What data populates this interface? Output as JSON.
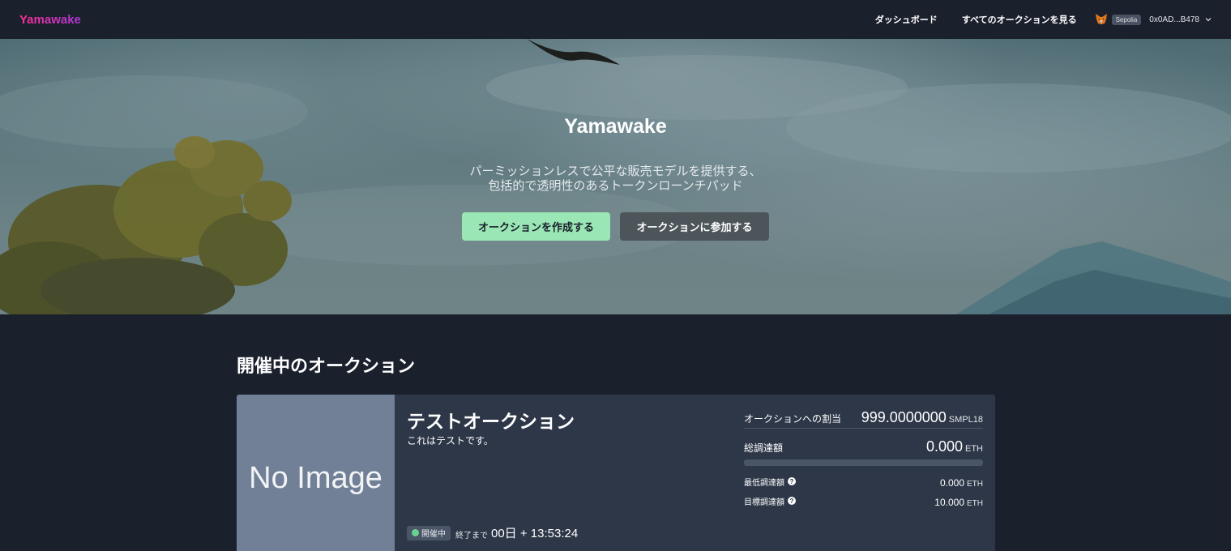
{
  "header": {
    "logo": "Yamawake",
    "nav": {
      "dashboard": "ダッシュボード",
      "all_auctions": "すべてのオークションを見る"
    },
    "wallet": {
      "network": "Sepolia",
      "address": "0x0AD...B478"
    }
  },
  "hero": {
    "title": "Yamawake",
    "subtitle_line1": "パーミッションレスで公平な販売モデルを提供する、",
    "subtitle_line2": "包括的で透明性のあるトークンローンチパッド",
    "create_button": "オークションを作成する",
    "join_button": "オークションに参加する"
  },
  "auctions": {
    "section_title": "開催中のオークション",
    "cards": [
      {
        "image_placeholder": "No Image",
        "title": "テストオークション",
        "description": "これはテストです。",
        "status": "開催中",
        "countdown_label": "終了まで",
        "countdown": "00日 + 13:53:24",
        "allocation_label": "オークションへの割当",
        "allocation_value": "999.0000000",
        "allocation_unit": "SMPL18",
        "raised_label": "総調達額",
        "raised_value": "0.000",
        "raised_unit": "ETH",
        "raised_progress": 0,
        "min_label": "最低調達額",
        "min_value": "0.000",
        "min_unit": "ETH",
        "target_label": "目標調達額",
        "target_value": "10.000",
        "target_unit": "ETH"
      }
    ]
  },
  "colors": {
    "background": "#1b202d",
    "card": "#2d3748",
    "primary_button": "#9ae6b4",
    "status_dot": "#68d391"
  },
  "icons": [
    "metamask-fox-icon",
    "chevron-down-icon",
    "help-icon",
    "status-dot"
  ]
}
